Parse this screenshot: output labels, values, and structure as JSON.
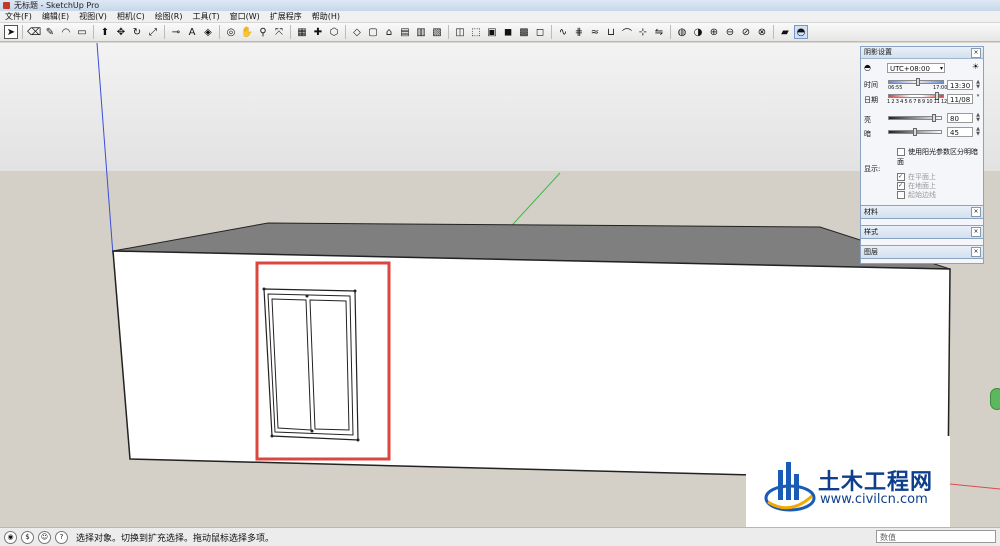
{
  "window": {
    "title": "无标题 - SketchUp Pro"
  },
  "menu": [
    "文件(F)",
    "编辑(E)",
    "视图(V)",
    "相机(C)",
    "绘图(R)",
    "工具(T)",
    "窗口(W)",
    "扩展程序",
    "帮助(H)"
  ],
  "toolbar": {
    "groups": [
      [
        "select-arrow-icon"
      ],
      [
        "eraser-icon",
        "pencil-line-icon",
        "arc-icon",
        "rectangle-icon"
      ],
      [
        "push-pull-icon",
        "move-icon",
        "rotate-icon",
        "scale-icon"
      ],
      [
        "tape-measure-icon",
        "text-icon",
        "paint-bucket-icon"
      ],
      [
        "orbit-icon",
        "pan-icon",
        "zoom-icon",
        "zoom-extents-icon"
      ],
      [
        "warehouse-icon",
        "extension-icon",
        "component-icon"
      ],
      [
        "iso-view-icon",
        "top-view-icon",
        "front-view-icon",
        "right-view-icon",
        "back-view-icon",
        "left-view-icon"
      ],
      [
        "xray-icon",
        "wireframe-icon",
        "hidden-line-icon",
        "shaded-icon",
        "textured-icon",
        "monochrome-icon"
      ],
      [
        "sandbox-contours-icon",
        "sandbox-mesh-icon",
        "smoove-icon",
        "stamp-icon",
        "drape-icon",
        "add-detail-icon",
        "flip-edge-icon"
      ],
      [
        "solid-outer-icon",
        "solid-intersect-icon",
        "solid-union-icon",
        "solid-subtract-icon",
        "solid-trim-icon",
        "solid-split-icon"
      ],
      [
        "section-plane-icon",
        "shadows-toggle-icon"
      ]
    ]
  },
  "shadow_panel": {
    "title": "阴影设置",
    "timezone": "UTC+08:00",
    "time_label": "时间",
    "time_start": "06:55",
    "time_end": "17:00",
    "time_value": "13:30",
    "date_label": "日期",
    "months": "1 2 3 4 5 6 7 8 9 10 11 12",
    "date_value": "11/08",
    "light_label": "亮",
    "light_value": "80",
    "dark_label": "暗",
    "dark_value": "45",
    "use_sun_label": "使用阳光参数区分明暗面",
    "display_label": "显示:",
    "on_faces": "在平面上",
    "on_ground": "在地面上",
    "from_edges": "起始边线"
  },
  "collapsed_panels": [
    "材料",
    "样式",
    "图层"
  ],
  "status": {
    "message": "选择对象。切换到扩充选择。拖动鼠标选择多项。",
    "measurements_label": "数值"
  },
  "watermark": {
    "title": "土木工程网",
    "url": "www.civilcn.com"
  },
  "scene": {
    "sky": "#ececec",
    "ground": "#d3cfc6",
    "roof": "#7d7d7d",
    "wall": "#ffffff",
    "highlight": "#d9473f"
  }
}
